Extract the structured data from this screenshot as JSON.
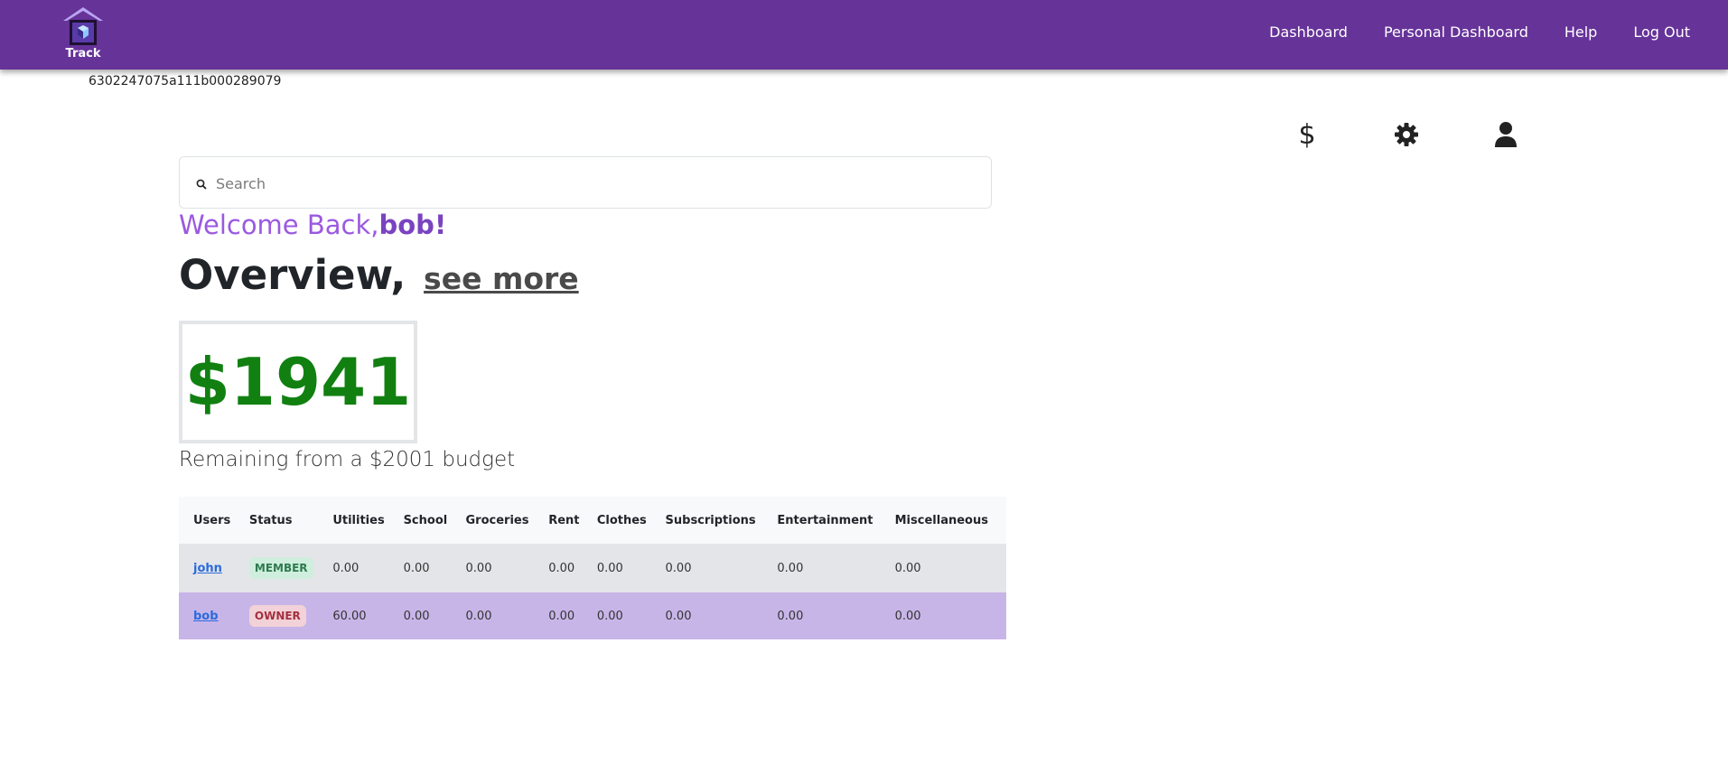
{
  "app": {
    "logo_text": "Track",
    "colors": {
      "nav": "#663399",
      "accent": "#9b59e0",
      "amount": "#118011"
    }
  },
  "nav": {
    "links": [
      "Dashboard",
      "Personal Dashboard",
      "Help",
      "Log Out"
    ]
  },
  "user_id": "6302247075a111b000289079",
  "icons": [
    "dollar-icon",
    "gear-icon",
    "user-icon"
  ],
  "search": {
    "placeholder": "Search",
    "value": ""
  },
  "welcome": {
    "prefix": "Welcome Back,",
    "username": "bob",
    "suffix": "!"
  },
  "overview": {
    "title": "Overview,",
    "link": "see more"
  },
  "summary": {
    "remaining_amount": "$1941",
    "remaining_text": "Remaining from a $2001 budget"
  },
  "table": {
    "headers": [
      "Users",
      "Status",
      "Utilities",
      "School",
      "Groceries",
      "Rent",
      "Clothes",
      "Subscriptions",
      "Entertainment",
      "Miscellaneous"
    ],
    "rows": [
      {
        "user": "john",
        "status": "MEMBER",
        "values": [
          "0.00",
          "0.00",
          "0.00",
          "0.00",
          "0.00",
          "0.00",
          "0.00",
          "0.00"
        ]
      },
      {
        "user": "bob",
        "status": "OWNER",
        "values": [
          "60.00",
          "0.00",
          "0.00",
          "0.00",
          "0.00",
          "0.00",
          "0.00",
          "0.00"
        ]
      }
    ]
  }
}
